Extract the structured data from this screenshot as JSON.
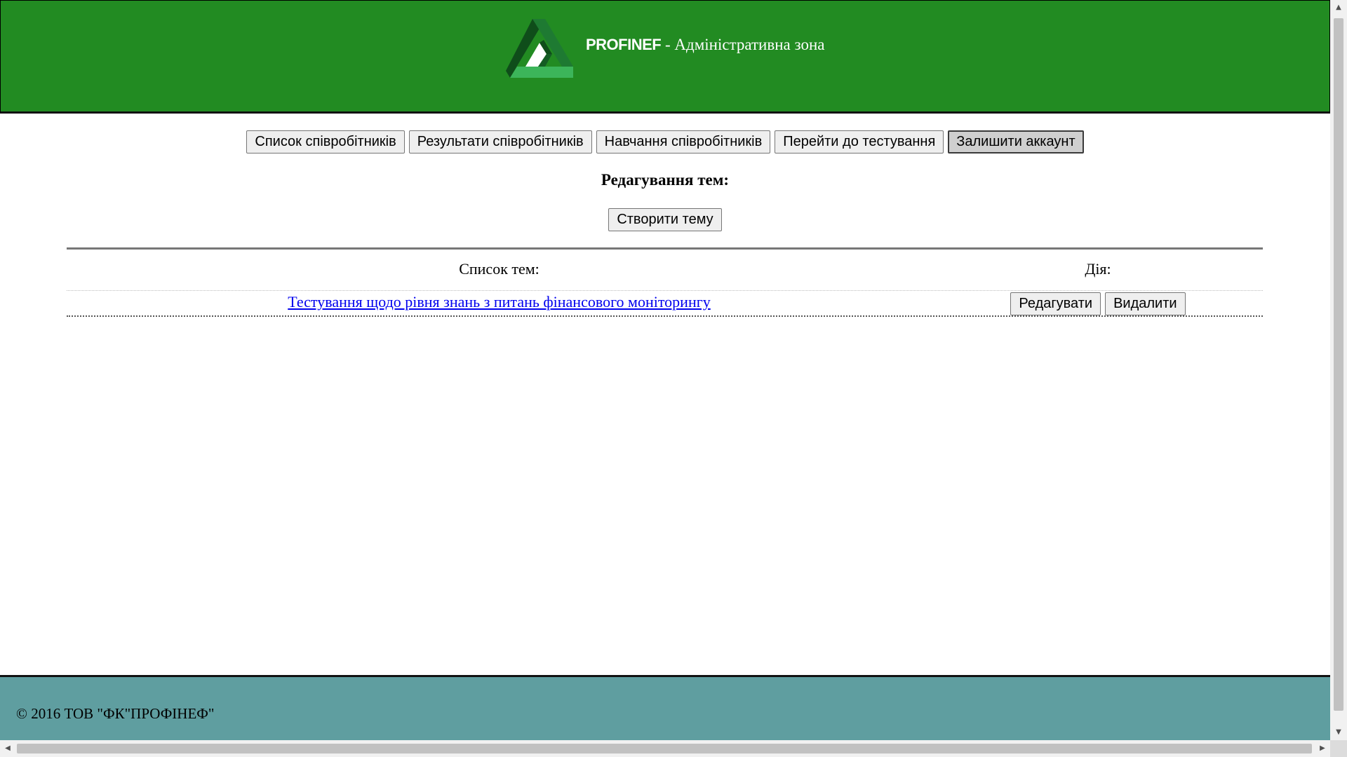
{
  "header": {
    "brand_name": "PROFINEF",
    "brand_suffix": " - Адміністративна зона",
    "logo_icon": "triangle-logo-icon",
    "colors": {
      "background": "#228b22",
      "logo_dark": "#0f4d1a",
      "logo_light": "#3cb55a"
    }
  },
  "nav": {
    "items": [
      {
        "label": "Список співробітників"
      },
      {
        "label": "Результати співробітників"
      },
      {
        "label": "Навчання співробітників"
      },
      {
        "label": "Перейти до тестування"
      },
      {
        "label": "Залишити аккаунт"
      }
    ]
  },
  "main": {
    "title": "Редагування тем:",
    "create_button": "Створити тему",
    "table": {
      "col_topics": "Список тем:",
      "col_action": "Дія:",
      "rows": [
        {
          "topic": "Тестування щодо рівня знань з питань фінансового моніторингу",
          "edit_label": "Редагувати",
          "delete_label": "Видалити"
        }
      ]
    }
  },
  "footer": {
    "copyright": "© 2016 ТОВ \"ФК\"ПРОФІНЕФ\"",
    "background": "#5f9ea0"
  },
  "scrollbars": {
    "up": "▲",
    "down": "▼",
    "left": "◀",
    "right": "▶"
  }
}
